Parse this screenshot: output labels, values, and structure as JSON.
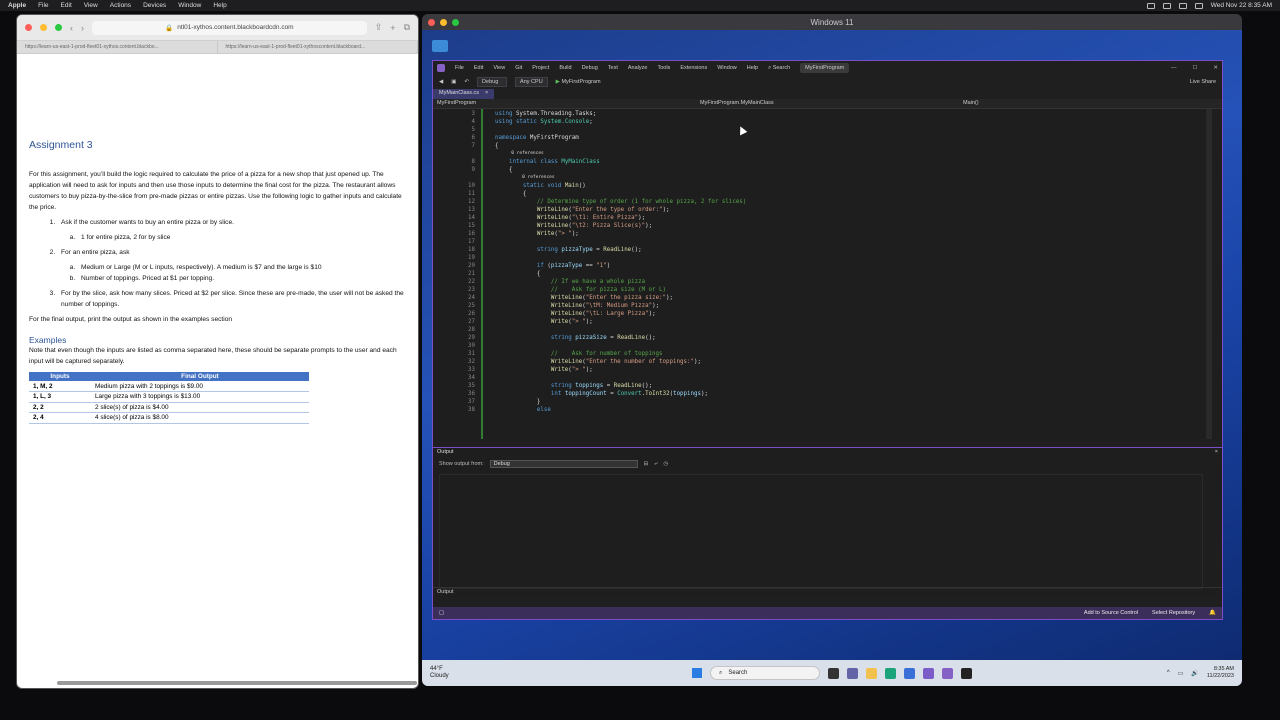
{
  "mac_menu": {
    "apple": "Apple",
    "items": [
      "File",
      "Edit",
      "View",
      "Actions",
      "Devices",
      "Window",
      "Help"
    ],
    "datetime": "Wed Nov 22  8:35 AM"
  },
  "safari": {
    "url": "ntl01-xythos.content.blackboardcdn.com",
    "tabs": [
      "https://learn-us-east-1-prod-fleet01-xythos.content.blackbo...",
      "https://learn-us-east-1-prod-fleet01-xythoscontent.blackboard..."
    ]
  },
  "doc": {
    "title": "Assignment 3",
    "intro": "For this assignment, you’ll build the logic required to calculate the price of a pizza for a new shop that just opened up. The application will need to ask for inputs and then use those inputs to determine the final cost for the pizza. The restaurant allows customers to buy pizza-by-the-slice from pre-made pizzas or entire pizzas. Use the following logic to gather inputs and calculate the price.",
    "step1": "Ask if the customer wants to buy an entire pizza or by slice.",
    "step1a": "1 for entire pizza, 2 for by slice",
    "step2": "For an entire pizza, ask",
    "step2a": "Medium or Large (M or L inputs, respectively). A medium is $7 and the large is $10",
    "step2b": "Number of toppings. Priced at $1 per topping.",
    "step3": "For by the slice, ask how many slices. Priced at $2 per slice. Since these are pre-made, the user will not be asked the number of toppings.",
    "final": "For the final output, print the output as shown in the examples section",
    "examples_heading": "Examples",
    "examples_note": "Note that even though the inputs are listed as comma separated here, these should be separate prompts to the user and each input will be captured separately.",
    "table_headers": [
      "Inputs",
      "Final Output"
    ],
    "table_rows": [
      [
        "1, M, 2",
        "Medium pizza with 2 toppings is $9.00"
      ],
      [
        "1, L, 3",
        "Large pizza with 3 toppings is $13.00"
      ],
      [
        "2, 2",
        "2 slice(s) of pizza is $4.00"
      ],
      [
        "2, 4",
        "4 slice(s) of pizza is $8.00"
      ]
    ]
  },
  "vm": {
    "title": "Windows 11"
  },
  "vs": {
    "menu": [
      "File",
      "Edit",
      "View",
      "Git",
      "Project",
      "Build",
      "Debug",
      "Test",
      "Analyze",
      "Tools",
      "Extensions",
      "Window",
      "Help"
    ],
    "search": "Search",
    "project": "MyFirstProgram",
    "config": "Debug",
    "platform": "Any CPU",
    "run": "MyFirstProgram",
    "live_share": "Live Share",
    "tab": "MyMainClass.cs",
    "nav": [
      "MyFirstProgram",
      "MyFirstProgram.MyMainClass",
      "Main()"
    ],
    "output_title": "Output",
    "output_from_label": "Show output from:",
    "output_from": "Debug",
    "footer_output": "Output",
    "status_left": "",
    "status_source": "Add to Source Control",
    "status_repo": "Select Repository"
  },
  "taskbar": {
    "temp": "44°F",
    "weather": "Cloudy",
    "search": "Search",
    "time": "8:35 AM",
    "date": "11/22/2023"
  }
}
